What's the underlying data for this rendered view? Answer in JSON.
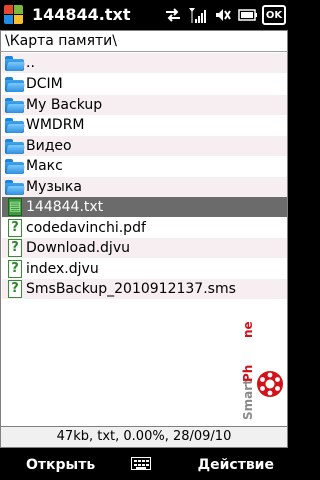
{
  "titlebar": {
    "title": "144844.txt",
    "icons": [
      "windows-logo-icon",
      "sync-arrows-icon",
      "signal-strength-icon",
      "volume-icon",
      "battery-icon"
    ],
    "ok_label": "OK"
  },
  "path": {
    "text": "\\Карта памяти\\"
  },
  "files": [
    {
      "name": "..",
      "type": "folder"
    },
    {
      "name": "DCIM",
      "type": "folder"
    },
    {
      "name": "My Backup",
      "type": "folder"
    },
    {
      "name": "WMDRM",
      "type": "folder"
    },
    {
      "name": "Видео",
      "type": "folder"
    },
    {
      "name": "Макс",
      "type": "folder"
    },
    {
      "name": "Музыка",
      "type": "folder"
    },
    {
      "name": "144844.txt",
      "type": "file",
      "selected": true
    },
    {
      "name": "codedavinchi.pdf",
      "type": "file"
    },
    {
      "name": "Download.djvu",
      "type": "file"
    },
    {
      "name": "index.djvu",
      "type": "file"
    },
    {
      "name": "SmsBackup_2010912137.sms",
      "type": "file"
    }
  ],
  "status": {
    "text": "47kb, txt, 0.00%, 28/09/10"
  },
  "softkeys": {
    "left": "Открыть",
    "right": "Действие"
  },
  "watermark": {
    "text": "SmartPhone"
  },
  "colors": {
    "selected_row": "#6b6b6b",
    "alt_row": "#f6eef1",
    "folder_blue": "#1c84d8",
    "file_green": "#3c9a3c"
  }
}
